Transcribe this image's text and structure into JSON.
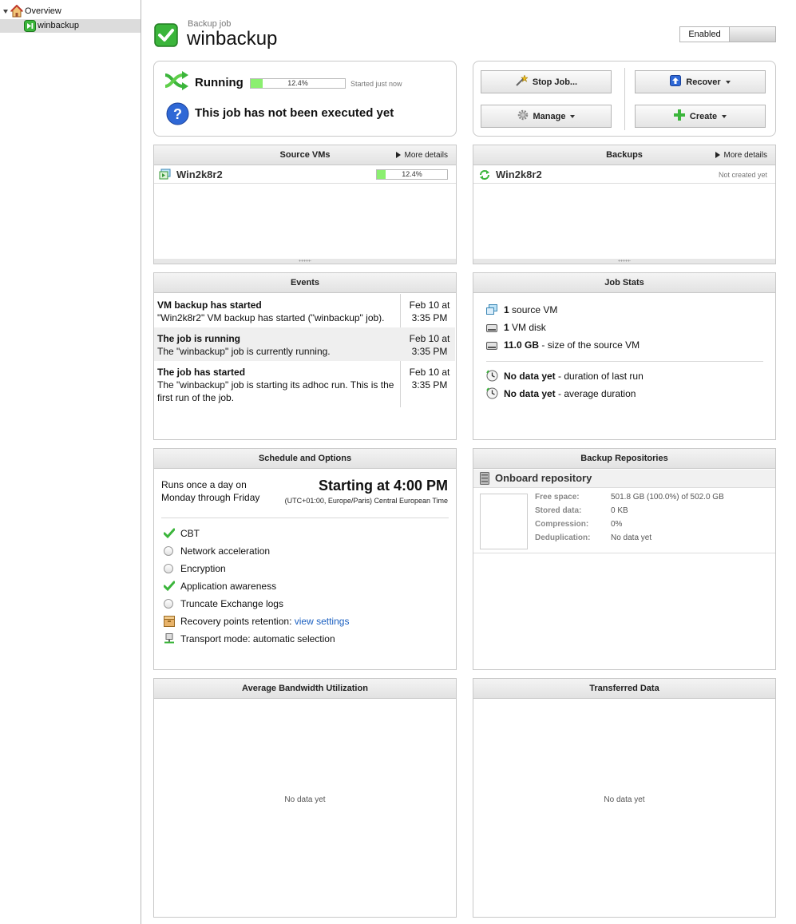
{
  "sidebar": {
    "items": [
      {
        "label": "Overview",
        "icon": "home-icon"
      },
      {
        "label": "winbackup",
        "icon": "backup-job-icon"
      }
    ]
  },
  "header": {
    "subtitle": "Backup job",
    "title": "winbackup",
    "enabled_label": "Enabled"
  },
  "status": {
    "state": "Running",
    "progress": 12.4,
    "progress_label": "12.4%",
    "started": "Started just now",
    "message": "This job has not been executed yet"
  },
  "actions": {
    "stop": "Stop Job...",
    "recover": "Recover",
    "manage": "Manage",
    "create": "Create"
  },
  "source_vms": {
    "title": "Source VMs",
    "more": "More details",
    "vm": "Win2k8r2",
    "progress": 12.4,
    "progress_label": "12.4%"
  },
  "backups": {
    "title": "Backups",
    "more": "More details",
    "vm": "Win2k8r2",
    "status": "Not created yet"
  },
  "events": {
    "title": "Events",
    "items": [
      {
        "title": "VM backup has started",
        "text": "\"Win2k8r2\" VM backup has started (\"winbackup\" job).",
        "date": "Feb 10 at",
        "time": "3:35 PM"
      },
      {
        "title": "The job is running",
        "text": "The \"winbackup\" job is currently running.",
        "date": "Feb 10 at",
        "time": "3:35 PM"
      },
      {
        "title": "The job has started",
        "text": "The \"winbackup\" job is starting its adhoc run. This is the first run of the job.",
        "date": "Feb 10 at",
        "time": "3:35 PM"
      }
    ]
  },
  "job_stats": {
    "title": "Job Stats",
    "rows": [
      {
        "bold": "1",
        "text": "source VM"
      },
      {
        "bold": "1",
        "text": "VM disk"
      },
      {
        "bold": "11.0 GB",
        "text": "- size of the source VM"
      },
      {
        "bold": "No data yet",
        "text": "- duration of last run"
      },
      {
        "bold": "No data yet",
        "text": "- average duration"
      }
    ]
  },
  "schedule": {
    "title": "Schedule and Options",
    "line1": "Runs once a day on",
    "line2": "Monday through Friday",
    "starting": "Starting at 4:00 PM",
    "timezone": "(UTC+01:00, Europe/Paris) Central European Time",
    "options": [
      {
        "label": "CBT",
        "state": "checked"
      },
      {
        "label": "Network acceleration",
        "state": "off"
      },
      {
        "label": "Encryption",
        "state": "off"
      },
      {
        "label": "Application awareness",
        "state": "checked"
      },
      {
        "label": "Truncate Exchange logs",
        "state": "off"
      }
    ],
    "retention_label": "Recovery points retention:",
    "retention_link": "view settings",
    "transport": "Transport mode: automatic selection"
  },
  "repositories": {
    "title": "Backup Repositories",
    "name": "Onboard repository",
    "fields": [
      {
        "label": "Free space:",
        "value": "501.8 GB (100.0%) of 502.0 GB"
      },
      {
        "label": "Stored data:",
        "value": "0 KB"
      },
      {
        "label": "Compression:",
        "value": "0%"
      },
      {
        "label": "Deduplication:",
        "value": "No data yet"
      }
    ]
  },
  "bandwidth": {
    "title": "Average Bandwidth Utilization",
    "empty": "No data yet"
  },
  "transferred": {
    "title": "Transferred Data",
    "empty": "No data yet"
  },
  "colors": {
    "accent_green": "#3bb53b",
    "progress_green": "#8bef70",
    "link_blue": "#1a5fc0"
  }
}
